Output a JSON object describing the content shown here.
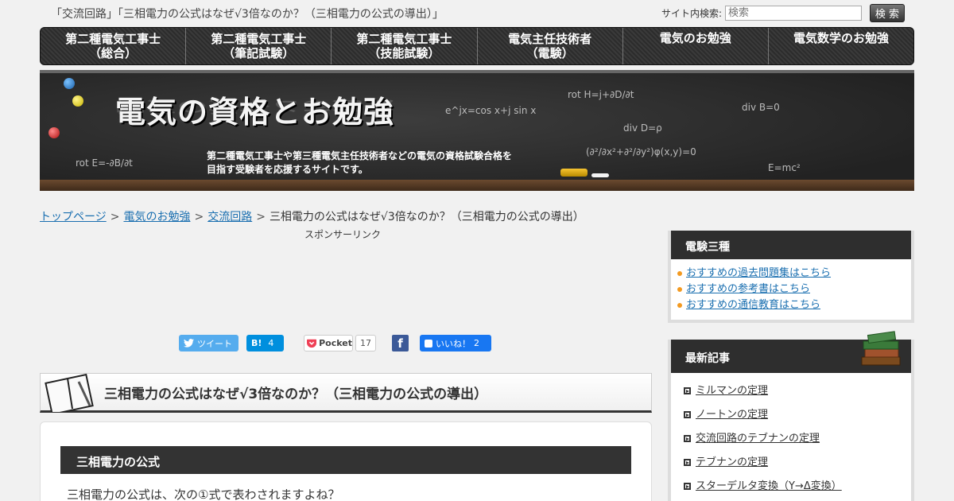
{
  "topline": "「交流回路」「三相電力の公式はなぜ√3倍なのか？（三相電力の公式の導出）」",
  "search": {
    "label": "サイト内検索:",
    "placeholder": "検索",
    "button": "検 索"
  },
  "nav": [
    {
      "line1": "第二種電気工事士",
      "line2": "（総合）"
    },
    {
      "line1": "第二種電気工事士",
      "line2": "（筆記試験）"
    },
    {
      "line1": "第二種電気工事士",
      "line2": "（技能試験）"
    },
    {
      "line1": "電気主任技術者",
      "line2": "（電験）"
    },
    {
      "line1": "電気のお勉強",
      "line2": ""
    },
    {
      "line1": "電気数学のお勉強",
      "line2": ""
    }
  ],
  "banner": {
    "title": "電気の資格とお勉強",
    "desc1": "第二種電気工事士や第三種電気主任技術者などの電気の資格試験合格を",
    "desc2": "目指す受験者を応援するサイトです。",
    "formulas": {
      "euler": "e^jx=cos x+j sin x",
      "roth": "rot H=j+∂D/∂t",
      "divb": "div B=0",
      "divd": "div D=ρ",
      "lap": "(∂²/∂x²+∂²/∂y²)φ(x,y)=0",
      "rote": "rot E=-∂B/∂t",
      "emc": "E=mc²"
    }
  },
  "breadcrumb": {
    "top": "トップページ",
    "study": "電気のお勉強",
    "ac": "交流回路",
    "current": "三相電力の公式はなぜ√3倍なのか？（三相電力の公式の導出）",
    "sep": ">"
  },
  "sponsor": "スポンサーリンク",
  "share": {
    "tweet": "ツイート",
    "hatena": "B!",
    "hatena_count": "4",
    "pocket": "Pocket",
    "pocket_count": "17",
    "fb": "f",
    "like": "いいね！",
    "like_count": "2"
  },
  "article": {
    "title": "三相電力の公式はなぜ√3倍なのか？（三相電力の公式の導出）",
    "section": "三相電力の公式",
    "text": "三相電力の公式は、次の①式で表わされますよね？"
  },
  "sidebar": {
    "w1_title": "電験三種",
    "w1_items": [
      "おすすめの過去問題集はこちら",
      "おすすめの参考書はこちら",
      "おすすめの通信教育はこちら"
    ],
    "w2_title": "最新記事",
    "w2_items": [
      "ミルマンの定理",
      "ノートンの定理",
      "交流回路のテブナンの定理",
      "テブナンの定理",
      "スターデルタ変換（Y→Δ変換）"
    ]
  },
  "colors": {
    "link": "#1a6fb0",
    "dark": "#2e2e2e",
    "accent": "#f39a21"
  }
}
